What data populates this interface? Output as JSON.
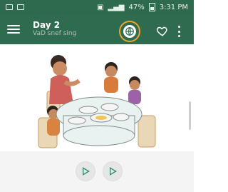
{
  "status_bar": {
    "battery_text": "47%",
    "time": "3:31 PM"
  },
  "app_bar": {
    "title": "Day 2",
    "subtitle": "VaD snef sing",
    "icons": [
      "menu-icon",
      "translate-icon",
      "heart-icon",
      "more-vert-icon"
    ]
  },
  "content": {
    "illustration": "family-dining-table-illustration"
  },
  "controls": {
    "buttons": [
      "play-icon",
      "play-icon"
    ]
  },
  "colors": {
    "primary": "#2f6b4e",
    "accent": "#f0a22a",
    "fab_bg": "#e6e6e6",
    "fab_icon": "#2e8b66"
  }
}
